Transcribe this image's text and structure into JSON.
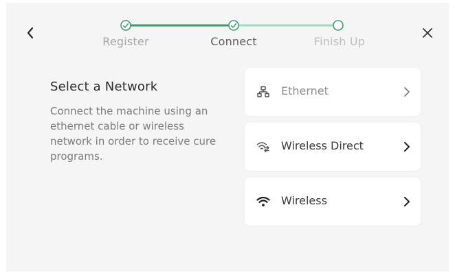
{
  "colors": {
    "accent": "#3a9a6a",
    "accent_light": "#a8d8bc",
    "background": "#f5f5f5",
    "card": "#ffffff"
  },
  "header": {
    "back_icon": "chevron-left-icon",
    "close_icon": "close-icon"
  },
  "steps": [
    {
      "label": "Register",
      "status": "completed",
      "icon": "check-icon"
    },
    {
      "label": "Connect",
      "status": "completed",
      "icon": "check-icon"
    },
    {
      "label": "Finish Up",
      "status": "pending",
      "icon": "empty-circle"
    }
  ],
  "section": {
    "title": "Select a Network",
    "description": "Connect the machine using an ethernet cable or wireless network in order to receive cure programs."
  },
  "options": [
    {
      "label": "Ethernet",
      "icon": "ethernet-icon",
      "chevron": "chevron-right-icon"
    },
    {
      "label": "Wireless Direct",
      "icon": "wireless-direct-icon",
      "chevron": "chevron-right-icon"
    },
    {
      "label": "Wireless",
      "icon": "wifi-icon",
      "chevron": "chevron-right-icon"
    }
  ]
}
